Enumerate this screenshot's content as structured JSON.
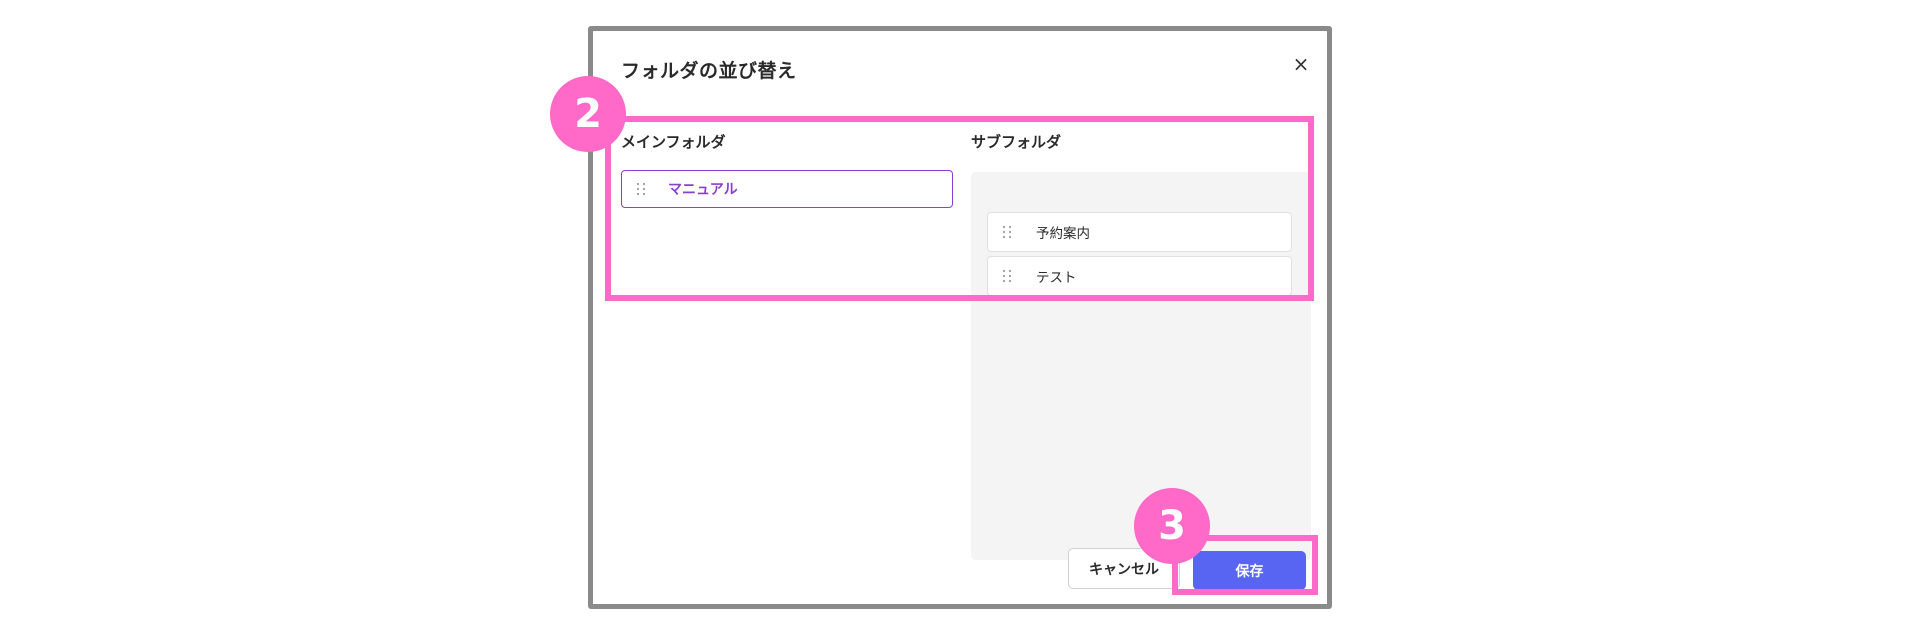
{
  "dialog": {
    "title": "フォルダの並び替え",
    "close_label": "×"
  },
  "main_folder": {
    "label": "メインフォルダ",
    "items": [
      {
        "label": "マニュアル"
      }
    ]
  },
  "sub_folder": {
    "label": "サブフォルダ",
    "items": [
      {
        "label": "予約案内"
      },
      {
        "label": "テスト"
      }
    ]
  },
  "buttons": {
    "cancel_label": "キャンセル",
    "save_label": "保存"
  },
  "annotations": {
    "badge_2": "2",
    "badge_3": "3"
  },
  "colors": {
    "accent_purple": "#8a3fd1",
    "primary_button": "#5865f2",
    "highlight_pink": "#ff69c7"
  },
  "icons": {
    "handle": "drag-handle-icon",
    "close": "close-icon"
  }
}
